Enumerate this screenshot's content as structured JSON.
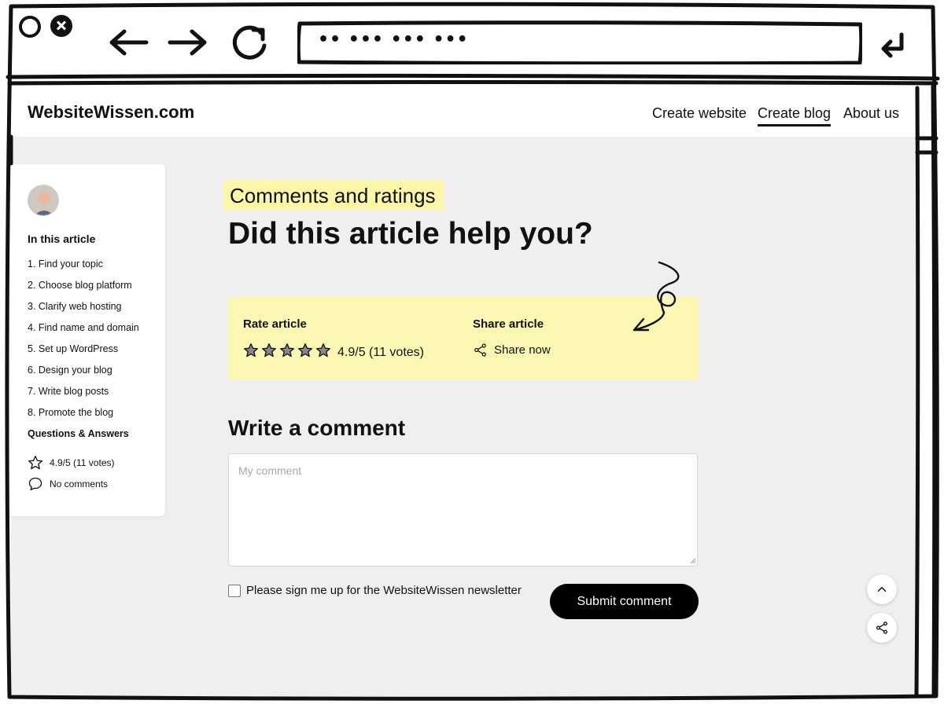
{
  "browser": {
    "url_text": "•• ••• ••• •••"
  },
  "header": {
    "logo": "WebsiteWissen.com",
    "nav": [
      "Create website",
      "Create blog",
      "About us"
    ],
    "active_nav": "Create blog"
  },
  "sidebar": {
    "toc_title": "In this article",
    "items": [
      "1. Find your topic",
      "2. Choose blog platform",
      "3. Clarify web hosting",
      "4. Find name and domain",
      "5. Set up WordPress",
      "6. Design your blog",
      "7. Write blog posts",
      "8. Promote the blog"
    ],
    "qa_label": "Questions & Answers",
    "rating": "4.9/5 (11 votes)",
    "comments": "No comments"
  },
  "main": {
    "eyebrow": "Comments and ratings",
    "headline": "Did this article help you?",
    "rate_label": "Rate article",
    "stars": 5,
    "rating_text": "4.9/5 (11 votes)",
    "share_label": "Share article",
    "share_now": "Share now",
    "comment_title": "Write a comment",
    "comment_placeholder": "My comment",
    "newsletter_label": "Please sign me up for the WebsiteWissen newsletter",
    "submit_label": "Submit comment"
  },
  "colors": {
    "highlight": "#fcf6a8",
    "panel": "#fcf8b3",
    "button": "#000000"
  },
  "icons": {
    "back": "arrow-left-icon",
    "forward": "arrow-right-icon",
    "reload": "reload-icon",
    "enter": "enter-icon",
    "star": "star-icon",
    "share": "share-icon",
    "comment": "comment-bubble-icon",
    "scroll_top": "chevron-up-icon"
  }
}
